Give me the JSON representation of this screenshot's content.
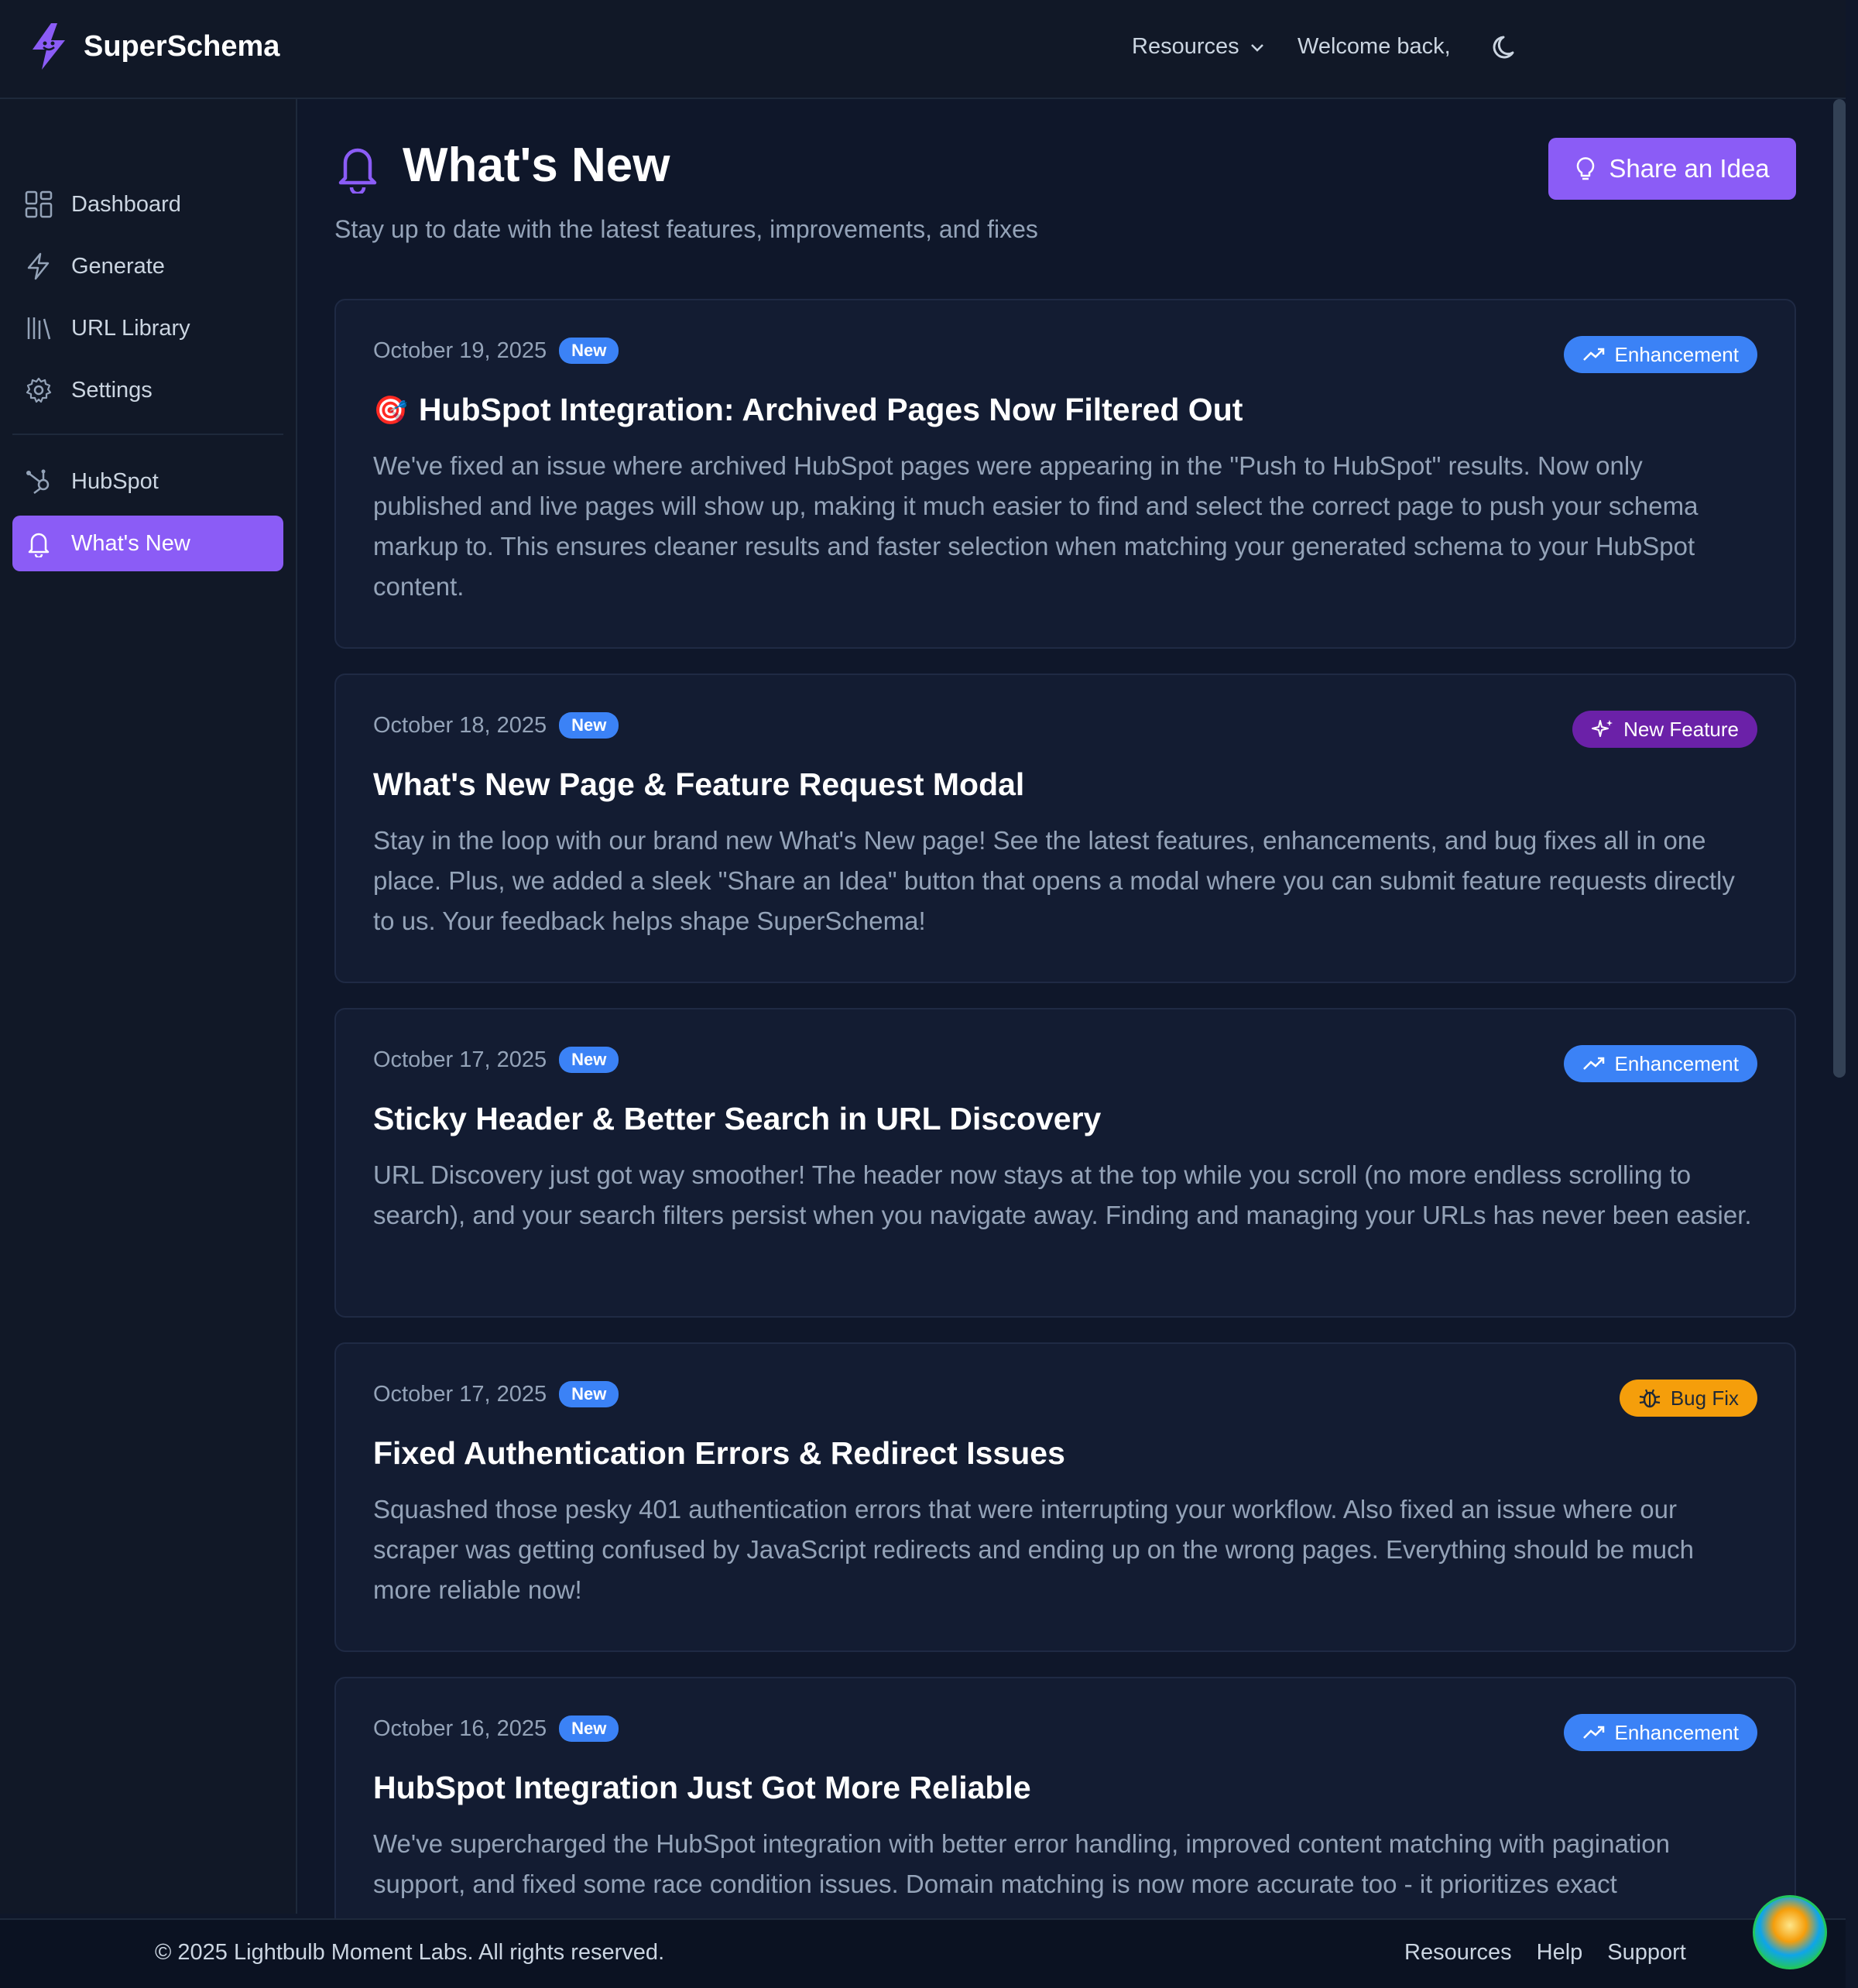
{
  "app": {
    "name": "SuperSchema"
  },
  "header": {
    "resources_label": "Resources",
    "welcome_text": "Welcome back,"
  },
  "sidebar": {
    "items": [
      {
        "label": "Dashboard",
        "icon": "dashboard-icon"
      },
      {
        "label": "Generate",
        "icon": "lightning-icon"
      },
      {
        "label": "URL Library",
        "icon": "library-icon"
      },
      {
        "label": "Settings",
        "icon": "gear-icon"
      },
      {
        "label": "HubSpot",
        "icon": "hubspot-icon"
      },
      {
        "label": "What's New",
        "icon": "bell-icon",
        "active": true
      }
    ]
  },
  "page": {
    "title": "What's New",
    "subtitle": "Stay up to date with the latest features, improvements, and fixes",
    "share_button": "Share an Idea"
  },
  "updates": [
    {
      "date": "October 19, 2025",
      "badge": "New",
      "tag": "Enhancement",
      "emoji": "🎯",
      "title": "HubSpot Integration: Archived Pages Now Filtered Out",
      "body": "We've fixed an issue where archived HubSpot pages were appearing in the \"Push to HubSpot\" results. Now only published and live pages will show up, making it much easier to find and select the correct page to push your schema markup to. This ensures cleaner results and faster selection when matching your generated schema to your HubSpot content."
    },
    {
      "date": "October 18, 2025",
      "badge": "New",
      "tag": "New Feature",
      "title": "What's New Page & Feature Request Modal",
      "body": "Stay in the loop with our brand new What's New page! See the latest features, enhancements, and bug fixes all in one place. Plus, we added a sleek \"Share an Idea\" button that opens a modal where you can submit feature requests directly to us. Your feedback helps shape SuperSchema!"
    },
    {
      "date": "October 17, 2025",
      "badge": "New",
      "tag": "Enhancement",
      "title": "Sticky Header & Better Search in URL Discovery",
      "body": "URL Discovery just got way smoother! The header now stays at the top while you scroll (no more endless scrolling to search), and your search filters persist when you navigate away. Finding and managing your URLs has never been easier."
    },
    {
      "date": "October 17, 2025",
      "badge": "New",
      "tag": "Bug Fix",
      "title": "Fixed Authentication Errors & Redirect Issues",
      "body": "Squashed those pesky 401 authentication errors that were interrupting your workflow. Also fixed an issue where our scraper was getting confused by JavaScript redirects and ending up on the wrong pages. Everything should be much more reliable now!"
    },
    {
      "date": "October 16, 2025",
      "badge": "New",
      "tag": "Enhancement",
      "title": "HubSpot Integration Just Got More Reliable",
      "body": "We've supercharged the HubSpot integration with better error handling, improved content matching with pagination support, and fixed some race condition issues. Domain matching is now more accurate too - it prioritizes exact"
    }
  ],
  "footer": {
    "copyright": "© 2025 Lightbulb Moment Labs. All rights reserved.",
    "links": [
      "Resources",
      "Help",
      "Support"
    ]
  },
  "colors": {
    "accent": "#8b5cf6",
    "enhancement": "#3b82f6",
    "new_feature": "#6b21a8",
    "bug_fix": "#f59e0b"
  }
}
